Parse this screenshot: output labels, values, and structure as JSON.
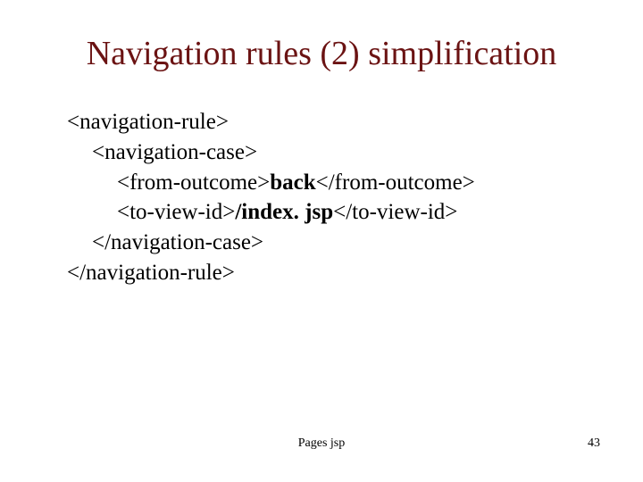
{
  "title": "Navigation rules (2) simplification",
  "code": {
    "l1": "<navigation-rule>",
    "l2": "<navigation-case>",
    "l3a": "<from-outcome>",
    "l3b": "back",
    "l3c": "</from-outcome>",
    "l4a": "<to-view-id>",
    "l4b": "/index. jsp",
    "l4c": "</to-view-id>",
    "l5": "</navigation-case>",
    "l6": "</navigation-rule>"
  },
  "footer": {
    "center": "Pages jsp",
    "page": "43"
  }
}
